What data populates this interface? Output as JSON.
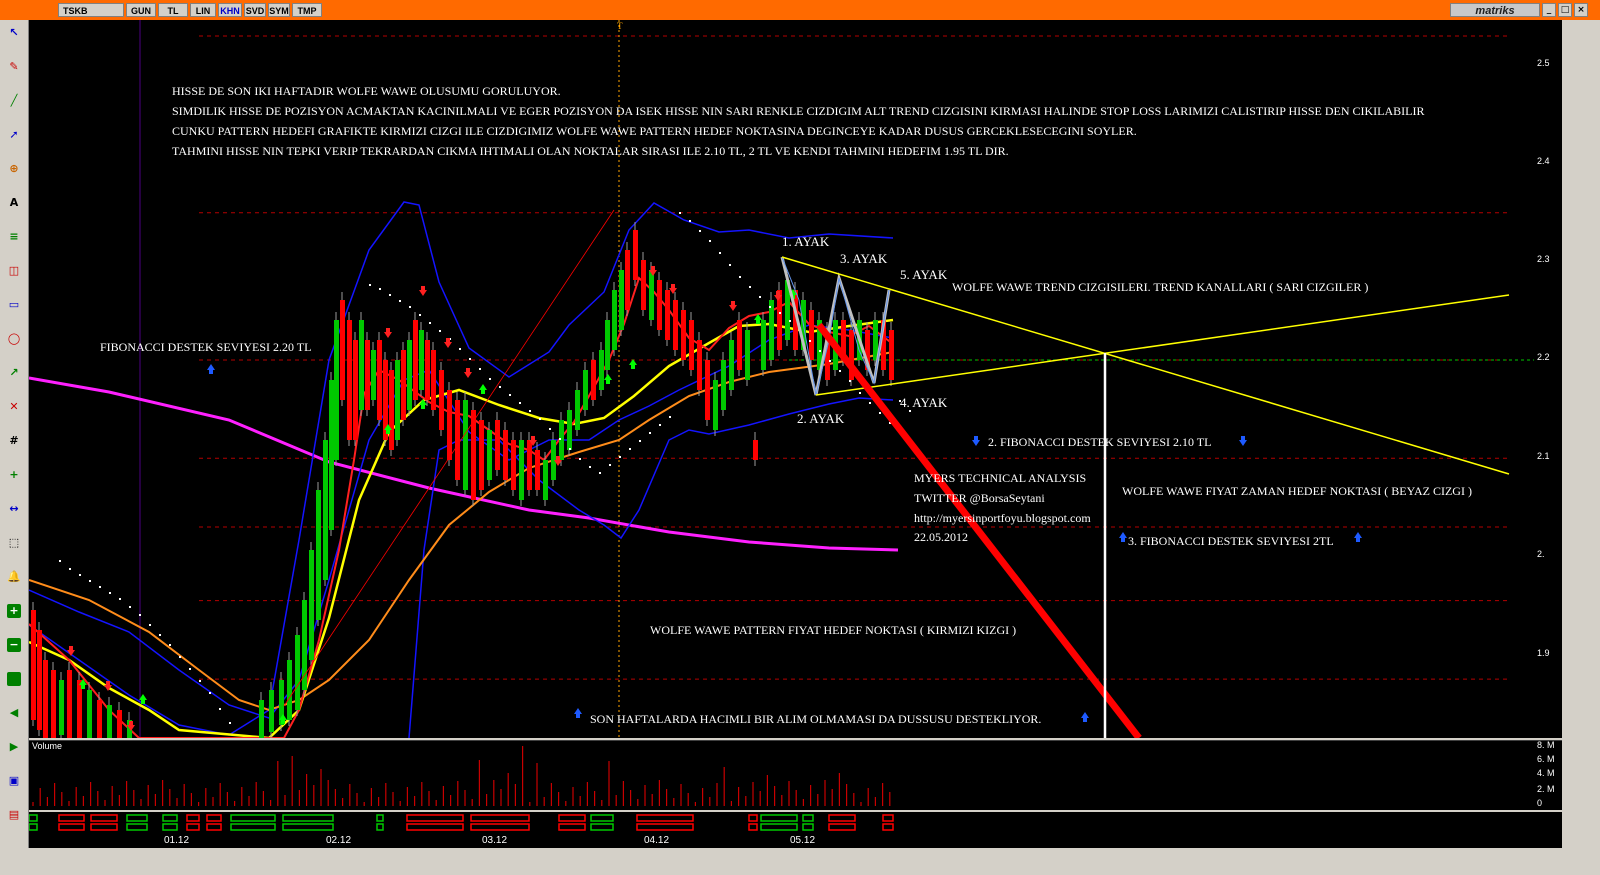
{
  "window": {
    "tabs": [
      "TSKB",
      "GUN",
      "TL",
      "LIN",
      "KHN",
      "SVD",
      "SYM",
      "TMP"
    ],
    "active_tab": "KHN",
    "brand": "matriks",
    "controls": [
      "_",
      "□",
      "×"
    ]
  },
  "toolbar_icons": [
    "cursor-icon",
    "pencil-icon",
    "line-icon",
    "arrow-icon",
    "zoom-icon",
    "text-icon",
    "fib-icon",
    "channel-icon",
    "rect-icon",
    "ellipse-icon",
    "trend-icon",
    "delete-icon",
    "grid-icon",
    "crosshair-icon",
    "measure-icon",
    "select-icon",
    "bell-icon",
    "plus-icon",
    "minus-icon",
    "refresh-icon",
    "back-icon",
    "forward-icon",
    "save-icon",
    "print-icon"
  ],
  "colors": {
    "background": "#000000",
    "up_candle": "#00c800",
    "down_candle": "#ff0000",
    "bollinger": "#1414ff",
    "ma_fast": "#ff2020",
    "ma_mid": "#ffff00",
    "ma_slow": "#ff8c1a",
    "ma_long": "#ff20ff",
    "trend_channel": "#ffff00",
    "target_line_red": "#ff0000",
    "time_target_white": "#ffffff",
    "grid_red": "#b40000",
    "support_green": "#00c800"
  },
  "annotations": {
    "main_1": "HISSE DE SON IKI HAFTADIR WOLFE WAWE OLUSUMU GORULUYOR.",
    "main_2": "SIMDILIK HISSE DE POZISYON ACMAKTAN KACINILMALI VE EGER POZISYON DA ISEK HISSE NIN SARI  RENKLE CIZDIGIM ALT TREND CIZGISINI KIRMASI HALINDE STOP LOSS LARIMIZI CALISTIRIP HISSE DEN CIKILABILIR",
    "main_3": "CUNKU PATTERN HEDEFI GRAFIKTE KIRMIZI CIZGI ILE CIZDIGIMIZ WOLFE WAWE PATTERN HEDEF NOKTASINA DEGINCEYE KADAR DUSUS GERCEKLESECEGINI SOYLER.",
    "main_4": "TAHMINI HISSE NIN TEPKI VERIP TEKRARDAN CIKMA IHTIMALI OLAN NOKTALAR SIRASI ILE 2.10 TL, 2 TL VE KENDI TAHMINI HEDEFIM 1.95 TL DIR.",
    "fib1": "FIBONACCI DESTEK SEVIYESI 2.20 TL",
    "ayak1": "1. AYAK",
    "ayak2": "2. AYAK",
    "ayak3": "3. AYAK",
    "ayak4": "4. AYAK",
    "ayak5": "5. AYAK",
    "trend_lines": "WOLFE WAWE TREND CIZGISILERI. TREND KANALLARI ( SARI CIZGILER )",
    "fib2": "2. FIBONACCI DESTEK SEVIYESI 2.10 TL",
    "myers": "MYERS TECHNICAL ANALYSIS",
    "twitter": "TWITTER @BorsaSeytani",
    "blog": "http://myersinportfoyu.blogspot.com",
    "date": "22.05.2012",
    "time_target": "WOLFE WAWE FIYAT ZAMAN HEDEF NOKTASI ( BEYAZ CIZGI )",
    "fib3": "3. FIBONACCI DESTEK SEVIYESI 2TL",
    "price_target": "WOLFE WAWE PATTERN FIYAT HEDEF NOKTASI ( KIRMIZI KIZGI )",
    "volume_note": "SON HAFTALARDA HACIMLI BIR ALIM OLMAMASI DA DUSSUSU DESTEKLIYOR."
  },
  "price_axis": [
    "2.5",
    "2.4",
    "2.3",
    "2.2",
    "2.1",
    "2.",
    "1.9"
  ],
  "volume_axis": [
    "8. M",
    "6. M",
    "4. M",
    "2. M",
    "0"
  ],
  "volume_title": "Volume",
  "date_axis": [
    "01.12",
    "02.12",
    "03.12",
    "04.12",
    "05.12"
  ],
  "cursor_marker": "T",
  "chart_data": {
    "type": "candlestick",
    "symbol": "TSKB",
    "price_ticks": [
      2.5,
      2.4,
      2.3,
      2.2,
      2.1,
      2.0,
      1.9
    ],
    "ylim": [
      1.82,
      2.53
    ],
    "support_levels": [
      2.2,
      2.1,
      2.0
    ],
    "volume_ticks_millions": [
      8,
      6,
      4,
      2,
      0
    ],
    "x_labels": [
      "01.12",
      "02.12",
      "03.12",
      "04.12",
      "05.12"
    ]
  }
}
